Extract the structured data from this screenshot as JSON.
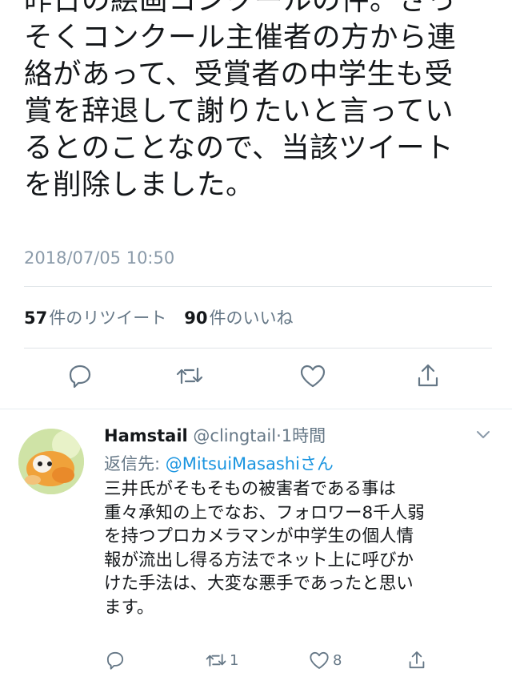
{
  "main_tweet": {
    "text": "昨日の絵画コンクールの件。さっ\nそくコンクール主催者の方から連\n絡があって、受賞者の中学生も受\n賞を辞退して謝りたいと言ってい\nるとのことなので、当該ツイート\nを削除しました。",
    "timestamp": "2018/07/05 10:50",
    "retweet_count": "57",
    "retweet_label": "件のリツイート",
    "like_count": "90",
    "like_label": "件のいいね"
  },
  "reply": {
    "name": "Hamstail",
    "handle": "@clingtail",
    "separator": "·",
    "time": "1時間",
    "replying_prefix": "返信先: ",
    "replying_mention": "@MitsuiMasashi",
    "replying_suffix": "さん",
    "text": "三井氏がそもそもの被害者である事は\n重々承知の上でなお、フォロワー8千人弱\nを持つプロカメラマンが中学生の個人情\n報が流出し得る方法でネット上に呼びか\nけた手法は、大変な悪手であったと思い\nます。",
    "retweet_count": "1",
    "like_count": "8"
  },
  "icons": {
    "reply": "reply-icon",
    "retweet": "retweet-icon",
    "like": "heart-icon",
    "share": "share-icon",
    "more": "chevron-down-icon"
  },
  "colors": {
    "text": "#14171a",
    "secondary": "#657786",
    "link": "#1b95e0",
    "divider": "#dfe4e8"
  }
}
